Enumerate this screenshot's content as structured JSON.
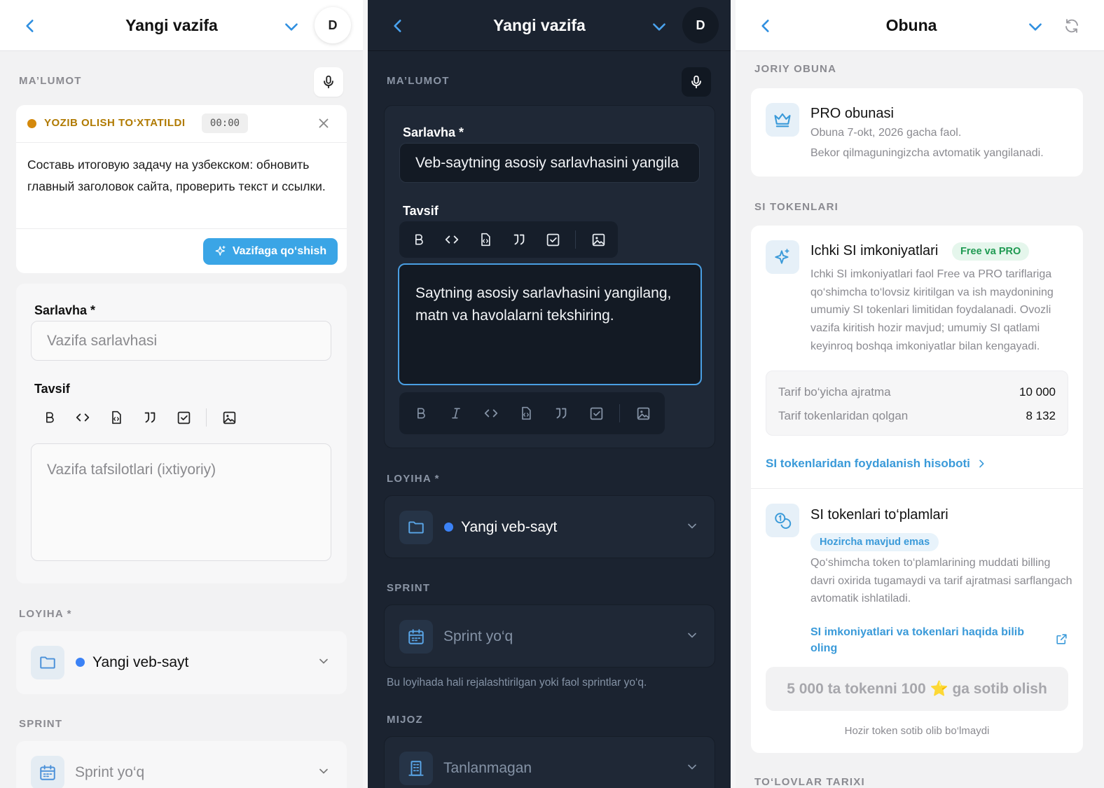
{
  "light_form": {
    "header": {
      "title": "Yangi vazifa",
      "avatar": "D"
    },
    "section_info": "MA’LUMOT",
    "recording": {
      "status": "YOZIB OLISH TO‘XTATILDI",
      "timer": "00:00",
      "transcript": "Составь итоговую задачу на узбекском: обновить главный заголовок сайта, проверить текст и ссылки.",
      "add_button": "Vazifaga qo‘shish"
    },
    "title_label": "Sarlavha *",
    "title_placeholder": "Vazifa sarlavhasi",
    "desc_label": "Tavsif",
    "desc_placeholder": "Vazifa tafsilotlari (ixtiyoriy)",
    "section_project": "LOYIHA *",
    "project_value": "Yangi veb-sayt",
    "section_sprint": "SPRINT",
    "sprint_value": "Sprint yo‘q"
  },
  "dark_form": {
    "header": {
      "title": "Yangi vazifa",
      "avatar": "D"
    },
    "section_info": "MA’LUMOT",
    "title_label": "Sarlavha *",
    "title_value": "Veb-saytning asosiy sarlavhasini yangila",
    "desc_label": "Tavsif",
    "desc_value": "Saytning asosiy sarlavhasini yangilang, matn va havolalarni tekshiring.",
    "section_project": "LOYIHA *",
    "project_value": "Yangi veb-sayt",
    "section_sprint": "SPRINT",
    "sprint_value": "Sprint yo‘q",
    "sprint_hint": "Bu loyihada hali rejalashtirilgan yoki faol sprintlar yo‘q.",
    "section_client": "MIJOZ",
    "client_value": "Tanlanmagan"
  },
  "subscription": {
    "header": {
      "title": "Obuna"
    },
    "section_current": "JORIY OBUNA",
    "plan_name": "PRO obunasi",
    "plan_status": "Obuna 7-okt, 2026 gacha faol.",
    "plan_renew": "Bekor qilmaguningizcha avtomatik yangilanadi.",
    "section_tokens": "SI TOKENLARI",
    "internal_title": "Ichki SI imkoniyatlari",
    "internal_badge": "Free va PRO",
    "internal_desc": "Ichki SI imkoniyatlari faol Free va PRO tariflariga qo‘shimcha to‘lovsiz kiritilgan va ish maydonining umumiy SI tokenlari limitidan foydalanadi. Ovozli vazifa kiritish hozir mavjud; umumiy SI qatlami keyinroq boshqa imkoniyatlar bilan kengayadi.",
    "allocation_label": "Tarif bo‘yicha ajratma",
    "allocation_value": "10 000",
    "remaining_label": "Tarif tokenlaridan qolgan",
    "remaining_value": "8 132",
    "usage_link": "SI tokenlaridan foydalanish hisoboti",
    "bundles_title": "SI tokenlari to‘plamlari",
    "bundles_badge": "Hozircha mavjud emas",
    "bundles_desc": "Qo‘shimcha token to‘plamlarining muddati billing davri oxirida tugamaydi va tarif ajratmasi sarflangach avtomatik ishlatiladi.",
    "learn_link": "SI imkoniyatlari va tokenlari haqida bilib oling",
    "buy_button": "5 000 ta tokenni 100 ⭐ ga sotib olish",
    "buy_note": "Hozir token sotib olib bo‘lmaydi",
    "section_payments": "TO‘LOVLAR TARIXI"
  },
  "colors": {
    "accent": "#2f8fe0",
    "amber": "#b07a00",
    "dark_bg": "#1b2330",
    "dark_card": "#1f2836",
    "dark_field": "#131a24",
    "green_badge": "#1f9a52"
  },
  "icons": [
    "back-icon",
    "chevron-down-icon",
    "microphone-icon",
    "close-icon",
    "sparkle-icon",
    "bold-icon",
    "italic-icon",
    "code-icon",
    "file-code-icon",
    "quote-icon",
    "checkbox-icon",
    "image-icon",
    "folder-icon",
    "calendar-icon",
    "building-icon",
    "refresh-icon",
    "crown-icon",
    "coins-icon",
    "external-link-icon",
    "chevron-right-icon"
  ]
}
